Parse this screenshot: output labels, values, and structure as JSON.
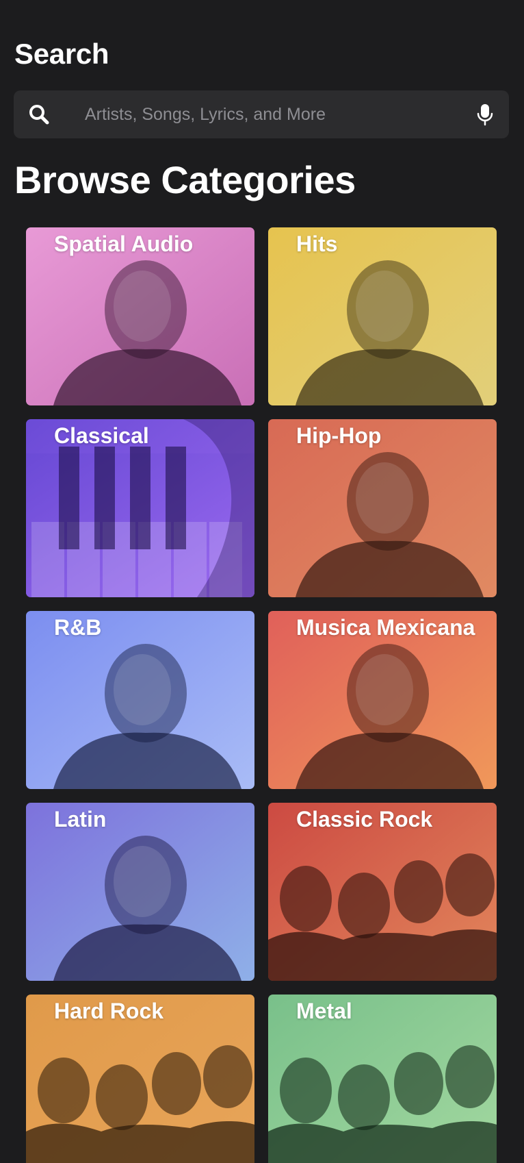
{
  "search": {
    "title": "Search",
    "placeholder": "Artists, Songs, Lyrics, and More"
  },
  "browse": {
    "title": "Browse Categories"
  },
  "categories": [
    {
      "label": "Spatial Audio",
      "color_a": "#e89ad6",
      "color_b": "#c96fb6",
      "shade": "#2a1026"
    },
    {
      "label": "Hits",
      "color_a": "#e6c34f",
      "color_b": "#e2cf7a",
      "shade": "#2a2210"
    },
    {
      "label": "Classical",
      "color_a": "#6b4bd6",
      "color_b": "#9b6af0",
      "shade": "#22155a"
    },
    {
      "label": "Hip-Hop",
      "color_a": "#d86a55",
      "color_b": "#e08a62",
      "shade": "#2a120c"
    },
    {
      "label": "R&B",
      "color_a": "#7c8ef0",
      "color_b": "#a9bcf6",
      "shade": "#12183a"
    },
    {
      "label": "Musica Mexicana",
      "color_a": "#e0605a",
      "color_b": "#f0985a",
      "shade": "#2a100c"
    },
    {
      "label": "Latin",
      "color_a": "#7d72dc",
      "color_b": "#8fb0e8",
      "shade": "#161238"
    },
    {
      "label": "Classic Rock",
      "color_a": "#cc4a42",
      "color_b": "#e2875c",
      "shade": "#2a0e0a"
    },
    {
      "label": "Hard Rock",
      "color_a": "#e09a4a",
      "color_b": "#e8a55a",
      "shade": "#2a1808"
    },
    {
      "label": "Metal",
      "color_a": "#79c08a",
      "color_b": "#a3d8a0",
      "shade": "#0e2414"
    }
  ]
}
